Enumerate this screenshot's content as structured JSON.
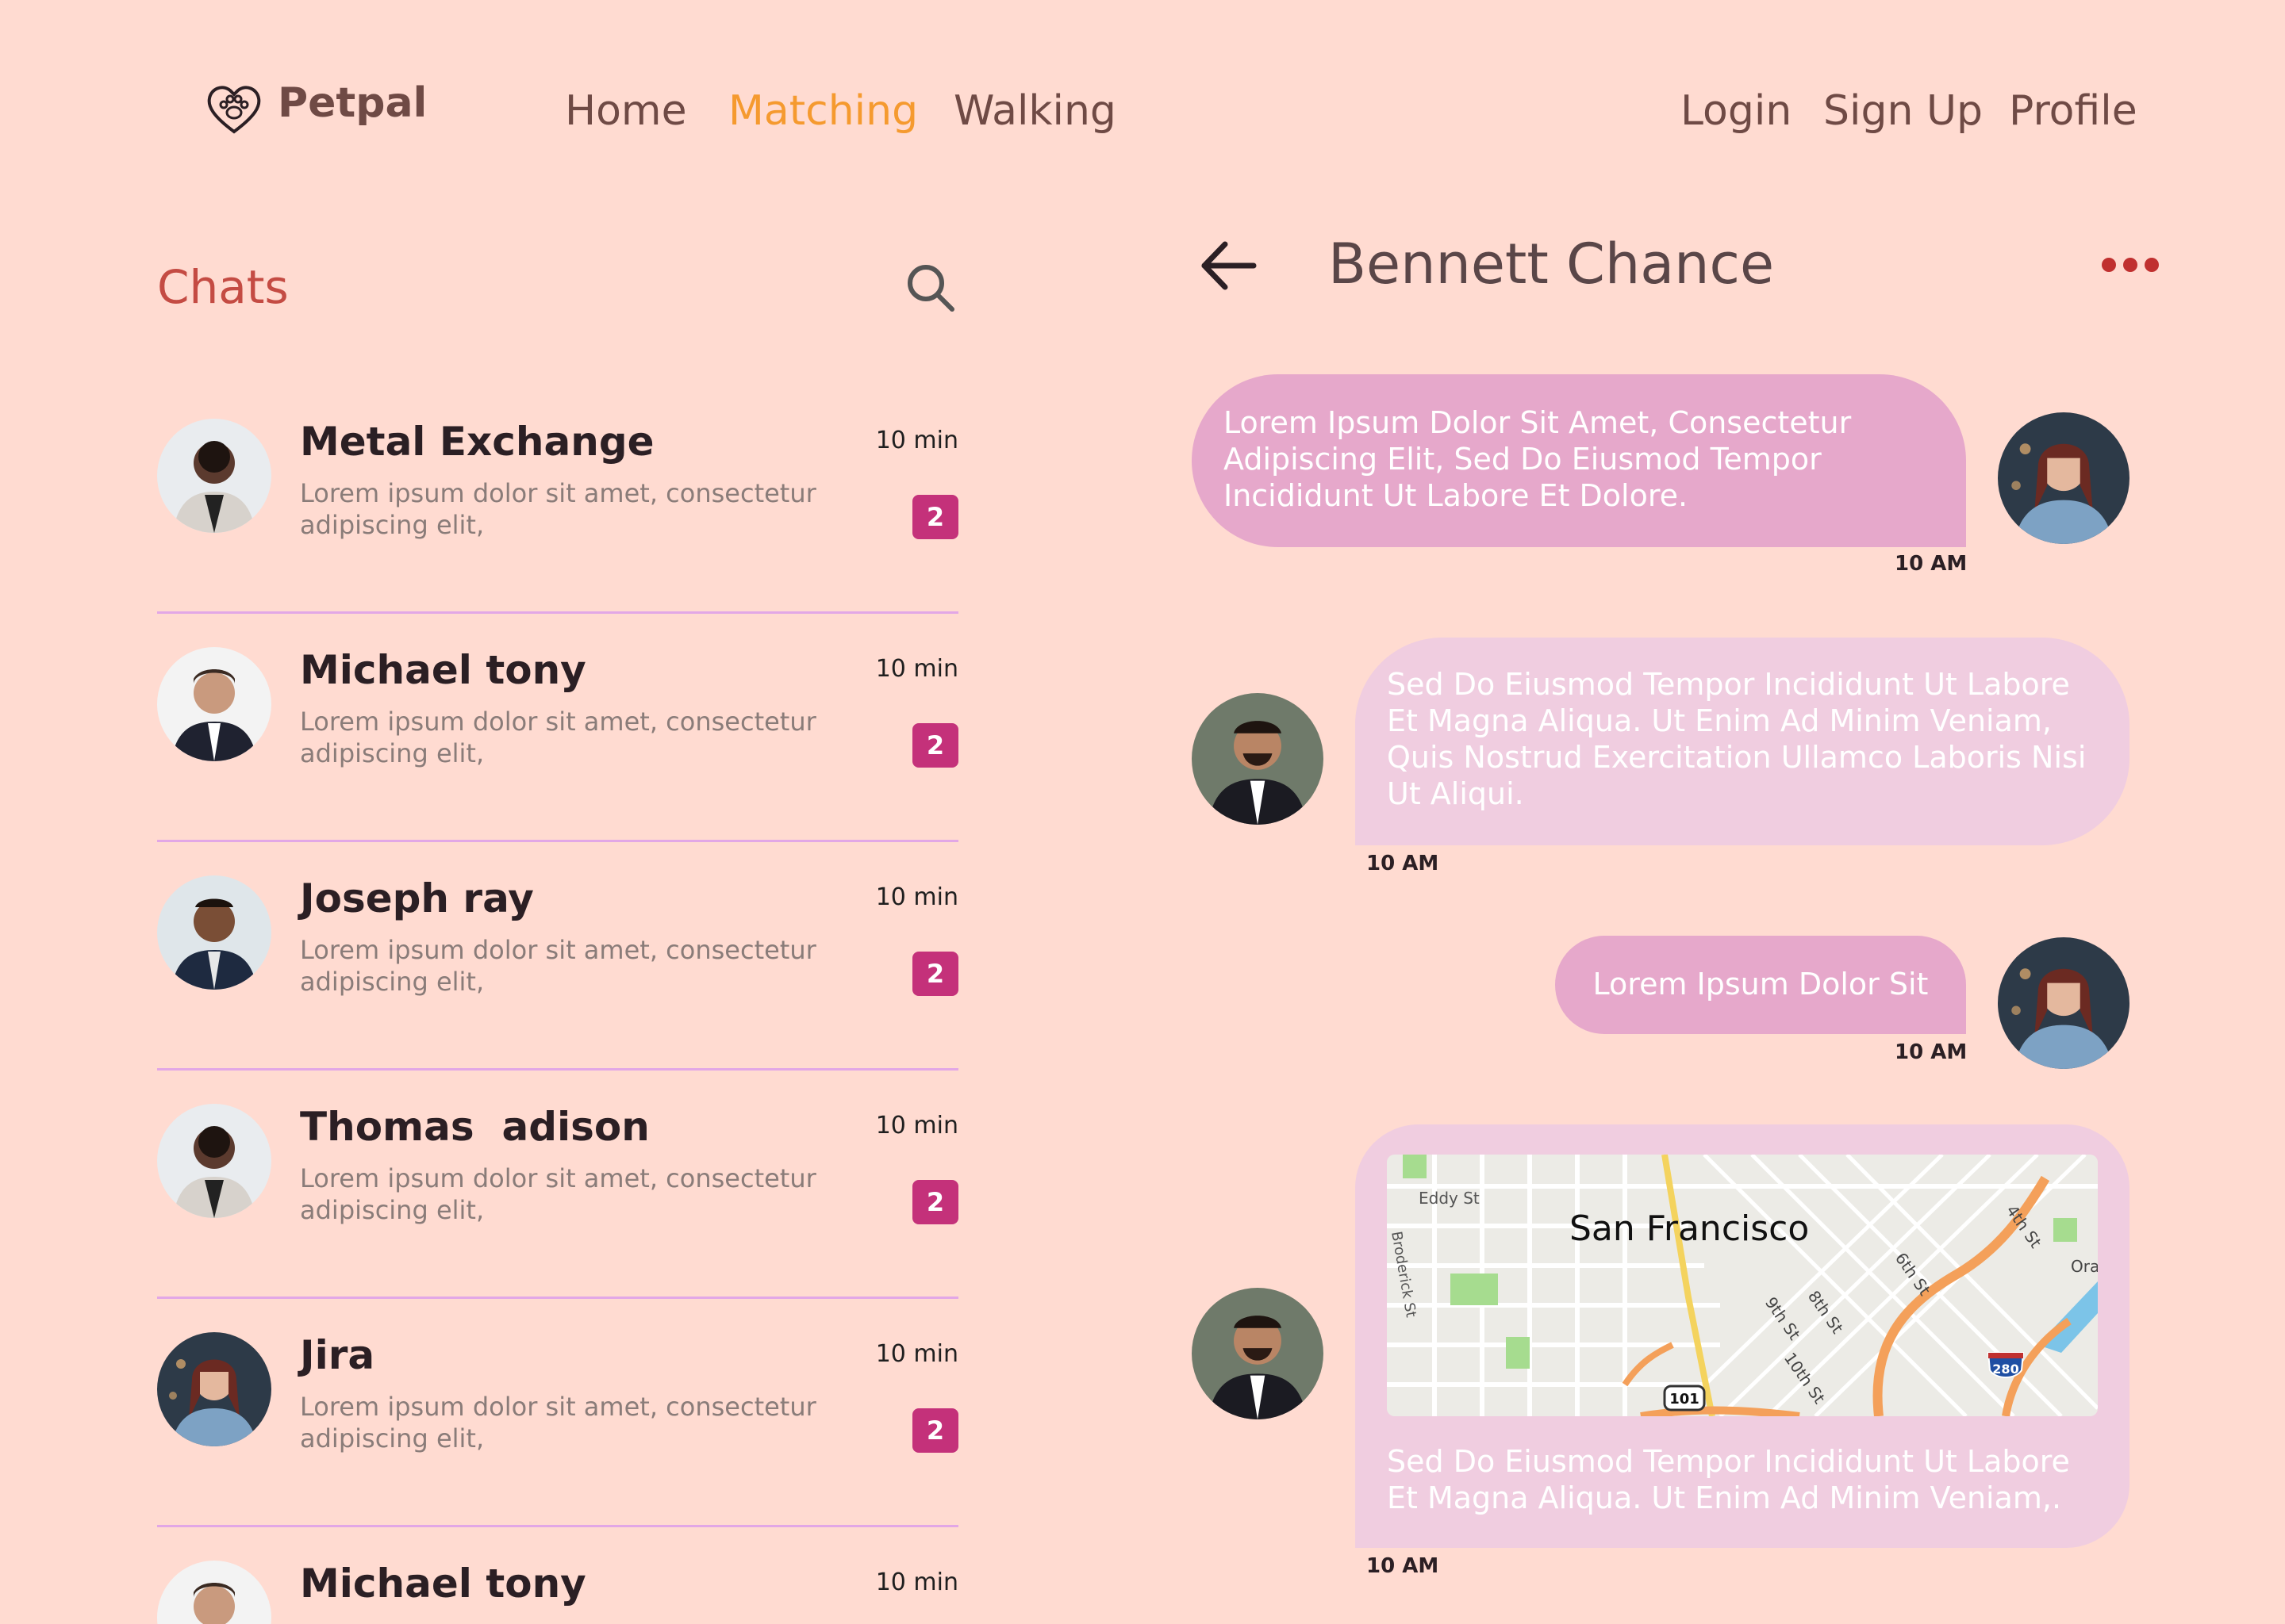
{
  "nav": {
    "brand": "Petpal",
    "links": [
      "Home",
      "Matching",
      "Walking"
    ],
    "active": "Matching",
    "auth": [
      "Login",
      "Sign Up",
      "Profile"
    ]
  },
  "colors": {
    "background": "#ffdbd1",
    "accent": "#f59a2f",
    "badge": "#c4317a",
    "title_red": "#c44b43",
    "bubble_out": "#e6a8cb",
    "bubble_in": "#f0cde0"
  },
  "chats": {
    "title": "Chats",
    "items": [
      {
        "name": "Metal Exchange",
        "time": "10 min",
        "preview": "Lorem ipsum dolor sit amet, consectetur adipiscing elit,",
        "unread": "2"
      },
      {
        "name": "Michael tony",
        "time": "10 min",
        "preview": "Lorem ipsum dolor sit amet, consectetur adipiscing elit,",
        "unread": "2"
      },
      {
        "name": "Joseph ray",
        "time": "10 min",
        "preview": "Lorem ipsum dolor sit amet, consectetur adipiscing elit,",
        "unread": "2"
      },
      {
        "name": "Thomas  adison",
        "time": "10 min",
        "preview": "Lorem ipsum dolor sit amet, consectetur adipiscing elit,",
        "unread": "2"
      },
      {
        "name": "Jira",
        "time": "10 min",
        "preview": "Lorem ipsum dolor sit amet, consectetur adipiscing elit,",
        "unread": "2"
      },
      {
        "name": "Michael tony",
        "time": "10 min"
      }
    ]
  },
  "conversation": {
    "contact": "Bennett Chance",
    "messages": [
      {
        "text": "Lorem Ipsum Dolor Sit Amet, Consectetur Adipiscing Elit, Sed Do Eiusmod Tempor Incididunt Ut Labore Et Dolore.",
        "time": "10 AM"
      },
      {
        "text": "Sed Do Eiusmod Tempor Incididunt Ut Labore Et Magna Aliqua. Ut Enim Ad Minim Veniam, Quis Nostrud Exercitation Ullamco Laboris Nisi Ut Aliqui.",
        "time": "10 AM"
      },
      {
        "text": "Lorem Ipsum Dolor Sit",
        "time": "10 AM"
      },
      {
        "text": "Sed Do Eiusmod Tempor Incididunt Ut Labore Et Magna Aliqua. Ut Enim Ad Minim Veniam,.",
        "time": "10 AM",
        "map": {
          "city": "San Francisco",
          "streets": [
            "Eddy St",
            "Broderick St",
            "6th St",
            "4th St",
            "8th St",
            "9th St",
            "10th St"
          ],
          "routes": [
            "101",
            "280"
          ],
          "edge_label": "Ora"
        }
      }
    ]
  }
}
